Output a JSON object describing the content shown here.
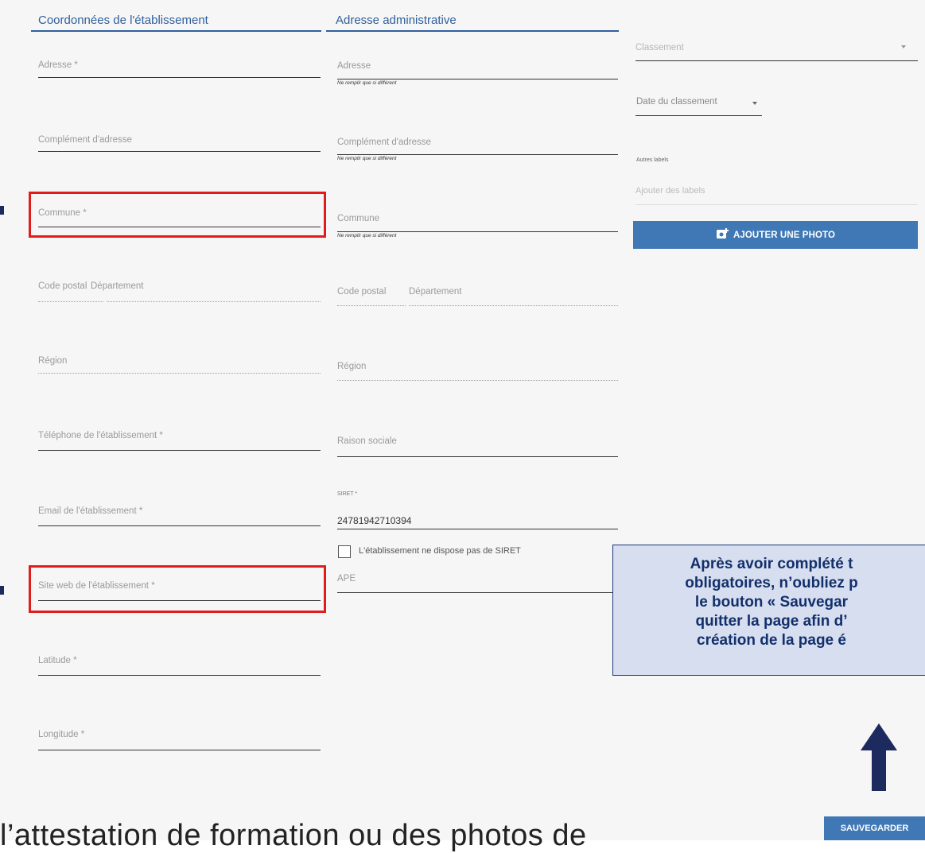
{
  "sections": {
    "etablissement_title": "Coordonnées de l'établissement",
    "admin_title": "Adresse administrative"
  },
  "etablissement": {
    "adresse": "Adresse *",
    "complement": "Complément d'adresse",
    "commune": "Commune *",
    "code_postal": "Code postal",
    "departement": "Département",
    "region": "Région",
    "telephone": "Téléphone de l'établissement *",
    "email": "Email de l'établissement *",
    "site_web": "Site web de l'établissement *",
    "latitude": "Latitude *",
    "longitude": "Longitude *"
  },
  "admin": {
    "adresse": "Adresse",
    "complement": "Complément d'adresse",
    "commune": "Commune",
    "hint": "Ne remplir que si différent",
    "code_postal": "Code postal",
    "departement": "Département",
    "region": "Région",
    "raison_sociale": "Raison sociale",
    "siret_label": "SIRET *",
    "siret_value": "24781942710394",
    "no_siret_label": "L'établissement ne dispose pas de SIRET",
    "ape": "APE"
  },
  "side": {
    "classement_placeholder": "Classement",
    "date_classement": "Date du classement",
    "autres_labels": "Autres labels",
    "labels_placeholder": "Ajouter des labels",
    "add_photo_label": "AJOUTER UNE PHOTO"
  },
  "callout": {
    "line1": "Après avoir complété t",
    "line2": "obligatoires, n’oubliez p",
    "line3": "le bouton « Sauvegar",
    "line4": "quitter la page afin d’",
    "line5": "création de la page é"
  },
  "save_label": "SAUVEGARDER",
  "bottom_text": "l’attestation de formation ou des photos de",
  "colors": {
    "accent": "#2f5f9e",
    "button": "#3f78b5",
    "highlight": "#e21b1b",
    "callout_bg": "#d6def0",
    "callout_text": "#13306b",
    "arrow": "#1c2a5e"
  }
}
